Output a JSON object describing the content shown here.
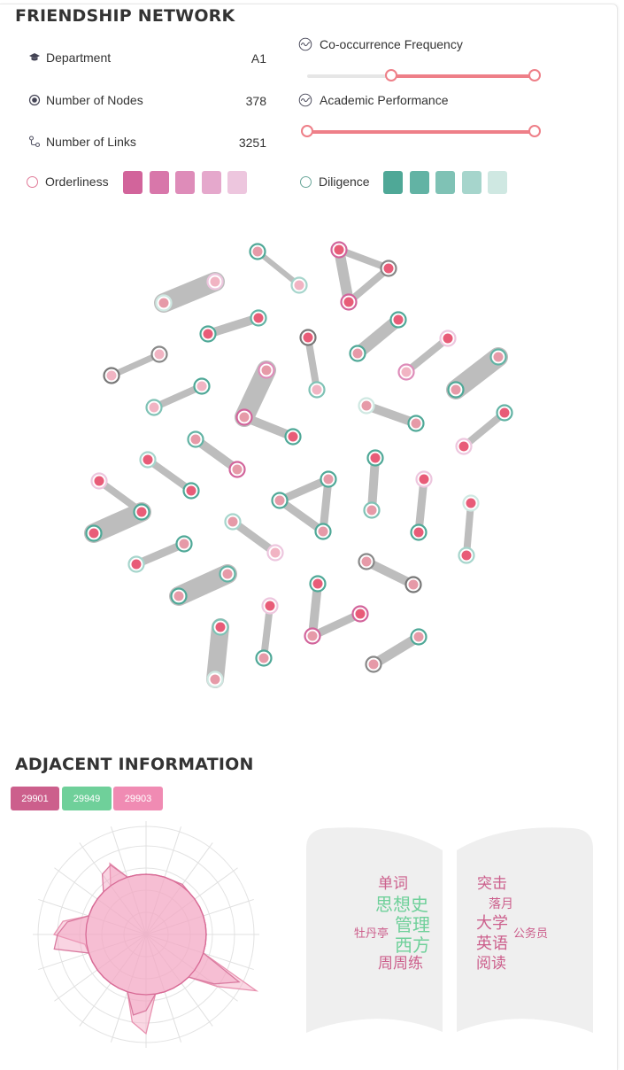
{
  "friendship": {
    "title": "FRIENDSHIP NETWORK",
    "stats": [
      {
        "label": "Department",
        "value": "A1",
        "icon": "graduation-cap-icon"
      },
      {
        "label": "Number of Nodes",
        "value": "378",
        "icon": "node-icon"
      },
      {
        "label": "Number of Links",
        "value": "3251",
        "icon": "link-icon"
      }
    ],
    "sliders": [
      {
        "label": "Co-occurrence Frequency",
        "icon": "wave-icon",
        "low": 0.37,
        "high": 1.0
      },
      {
        "label": "Academic Performance",
        "icon": "wave-icon",
        "low": 0.0,
        "high": 1.0
      }
    ],
    "orderliness": {
      "label": "Orderliness",
      "colors": [
        "#d2649b",
        "#d877aa",
        "#de8cb9",
        "#e5a8cc",
        "#edc6de"
      ]
    },
    "diligence": {
      "label": "Diligence",
      "colors": [
        "#4fa897",
        "#62b3a4",
        "#7fc2b5",
        "#a6d5cc",
        "#cfe8e2"
      ]
    }
  },
  "adjacent": {
    "title": "ADJACENT INFORMATION",
    "badges": [
      {
        "label": "29901",
        "color": "#cc5f8c"
      },
      {
        "label": "29949",
        "color": "#6fd09a"
      },
      {
        "label": "29903",
        "color": "#f08bb3"
      }
    ],
    "words_left": [
      {
        "text": "单词",
        "color": "#cc5f8c"
      },
      {
        "text": "思想史",
        "color": "#6fd09a"
      },
      {
        "text": "管理",
        "color": "#6fd09a"
      },
      {
        "text": "牡丹亭",
        "color": "#cc5f8c"
      },
      {
        "text": "西方",
        "color": "#6fd09a"
      },
      {
        "text": "周周练",
        "color": "#cc5f8c"
      }
    ],
    "words_right": [
      {
        "text": "突击",
        "color": "#cc5f8c"
      },
      {
        "text": "落月",
        "color": "#cc5f8c"
      },
      {
        "text": "大学",
        "color": "#cc5f8c"
      },
      {
        "text": "公务员",
        "color": "#cc5f8c"
      },
      {
        "text": "英语",
        "color": "#cc5f8c"
      },
      {
        "text": "阅读",
        "color": "#cc5f8c"
      }
    ]
  },
  "colors": {
    "accent": "#ee7f88",
    "node_pink": "#e85c78",
    "link_gray": "#bdbdbd"
  }
}
